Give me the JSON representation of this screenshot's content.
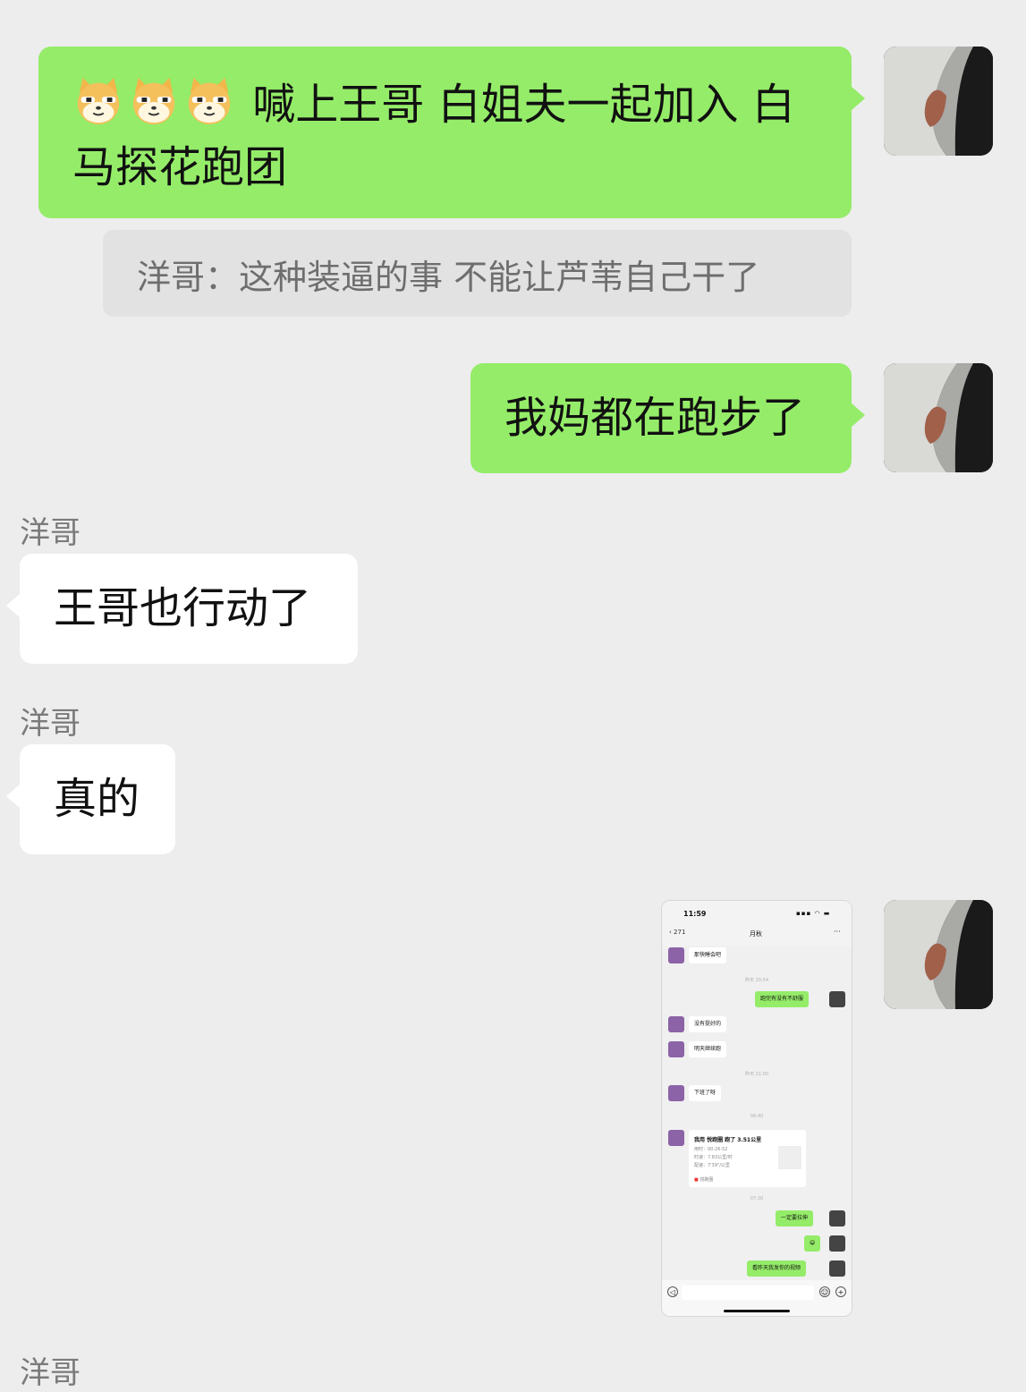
{
  "messages": {
    "m1": {
      "emoji_icons": [
        "doge-emoji",
        "doge-emoji",
        "doge-emoji"
      ],
      "line1": "喊上王哥 白姐夫一起加入 白",
      "line2": "马探花跑团"
    },
    "quote": "洋哥：这种装逼的事 不能让芦苇自己干了",
    "m2": "我妈都在跑步了",
    "m3": {
      "sender": "洋哥",
      "text": "王哥也行动了"
    },
    "m4": {
      "sender": "洋哥",
      "text": "真的"
    },
    "m6": {
      "sender": "洋哥"
    }
  },
  "screenshot": {
    "time": "11:59",
    "back_count": "271",
    "chat_title": "月秋",
    "more": "···",
    "msg1": "那快睡会吧",
    "ts1": "昨天 20:54",
    "msg2": "跑完有没有不舒服",
    "msg3": "没有挺好的",
    "msg4": "明天继续跑",
    "ts2": "昨天 21:00",
    "msg5": "下班了呀",
    "ts3": "06:40",
    "card_title": "我用 悦跑圈 跑了 3.51公里",
    "card_l1": "用时：00:26:52",
    "card_l2": "时速：7.83公里/时",
    "card_l3": "配速：7'39\"/公里",
    "card_src": "悦跑圈",
    "ts4": "07:30",
    "msg6": "一定要拉伸",
    "msg7": "😄",
    "msg8": "看昨天我发你的视频"
  },
  "colors": {
    "my_bubble": "#95ec69",
    "other_bubble": "#ffffff",
    "background": "#ededed",
    "quote_bg": "#e2e2e2"
  }
}
